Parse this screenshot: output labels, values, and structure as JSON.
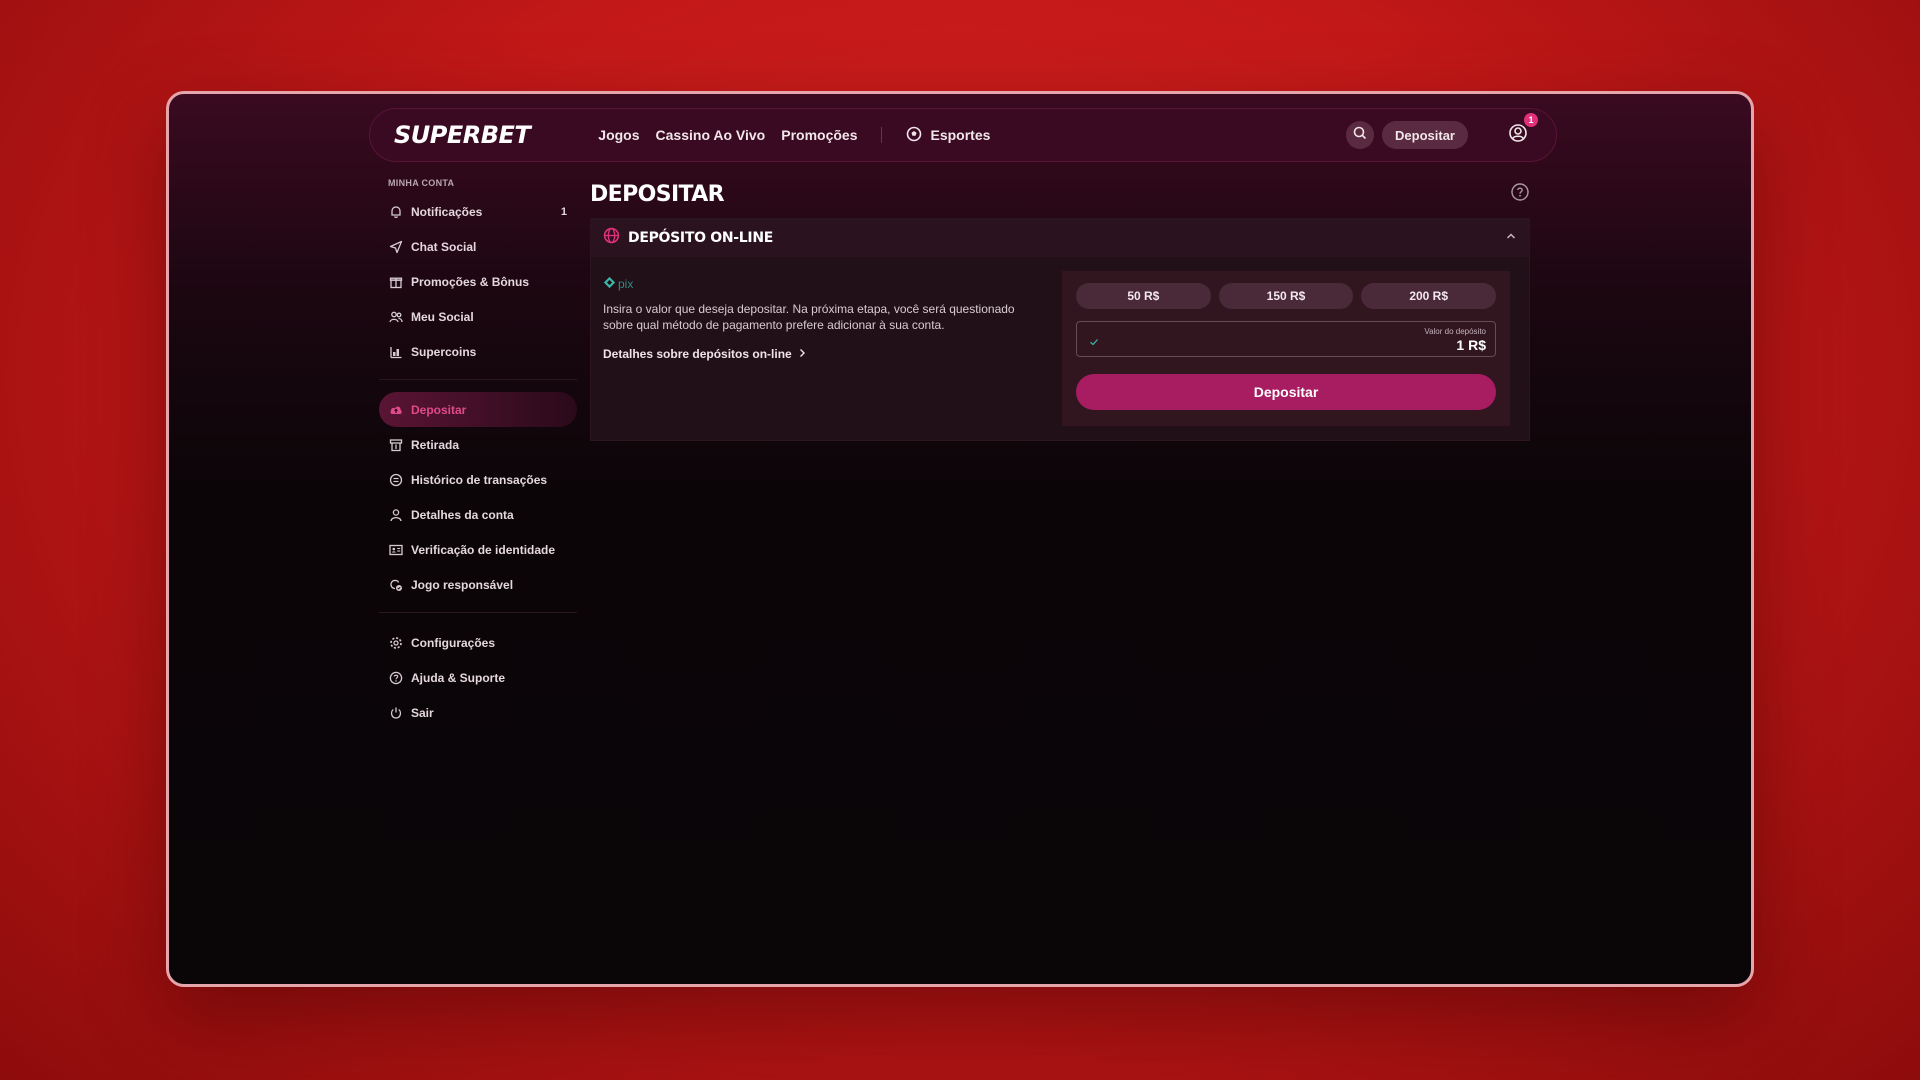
{
  "header": {
    "logo": "SUPERBET",
    "nav": [
      "Jogos",
      "Cassino Ao Vivo",
      "Promoções"
    ],
    "sports_label": "Esportes",
    "deposit_label": "Depositar",
    "notification_count": "1"
  },
  "sidebar": {
    "section_title": "MINHA CONTA",
    "group1": [
      {
        "label": "Notificações",
        "icon": "bell-icon",
        "count": "1"
      },
      {
        "label": "Chat Social",
        "icon": "send-icon"
      },
      {
        "label": "Promoções & Bônus",
        "icon": "gift-icon"
      },
      {
        "label": "Meu Social",
        "icon": "users-icon"
      },
      {
        "label": "Supercoins",
        "icon": "supercoins-icon"
      }
    ],
    "group2": [
      {
        "label": "Depositar",
        "icon": "cloud-upload-icon",
        "active": true
      },
      {
        "label": "Retirada",
        "icon": "wallet-icon"
      },
      {
        "label": "Histórico de transações",
        "icon": "history-icon"
      },
      {
        "label": "Detalhes da conta",
        "icon": "user-icon"
      },
      {
        "label": "Verificação de identidade",
        "icon": "id-card-icon"
      },
      {
        "label": "Jogo responsável",
        "icon": "shield-icon"
      }
    ],
    "group3": [
      {
        "label": "Configurações",
        "icon": "gear-icon"
      },
      {
        "label": "Ajuda & Suporte",
        "icon": "help-icon"
      },
      {
        "label": "Sair",
        "icon": "power-icon"
      }
    ]
  },
  "main": {
    "title": "DEPOSITAR",
    "panel_title": "DEPÓSITO ON-LINE",
    "method_name": "pix",
    "description": "Insira o valor que deseja depositar. Na próxima etapa, você será questionado sobre qual método de pagamento prefere adicionar à sua conta.",
    "details_link": "Detalhes sobre depósitos on-line",
    "quick_amounts": [
      "50  R$",
      "150  R$",
      "200  R$"
    ],
    "amount_label": "Valor do depósito",
    "amount_value": "1 R$",
    "submit_label": "Depositar"
  },
  "colors": {
    "accent": "#a81c62",
    "active_text": "#e04a8a",
    "pix": "#39b7a8",
    "background": "#c31818"
  }
}
